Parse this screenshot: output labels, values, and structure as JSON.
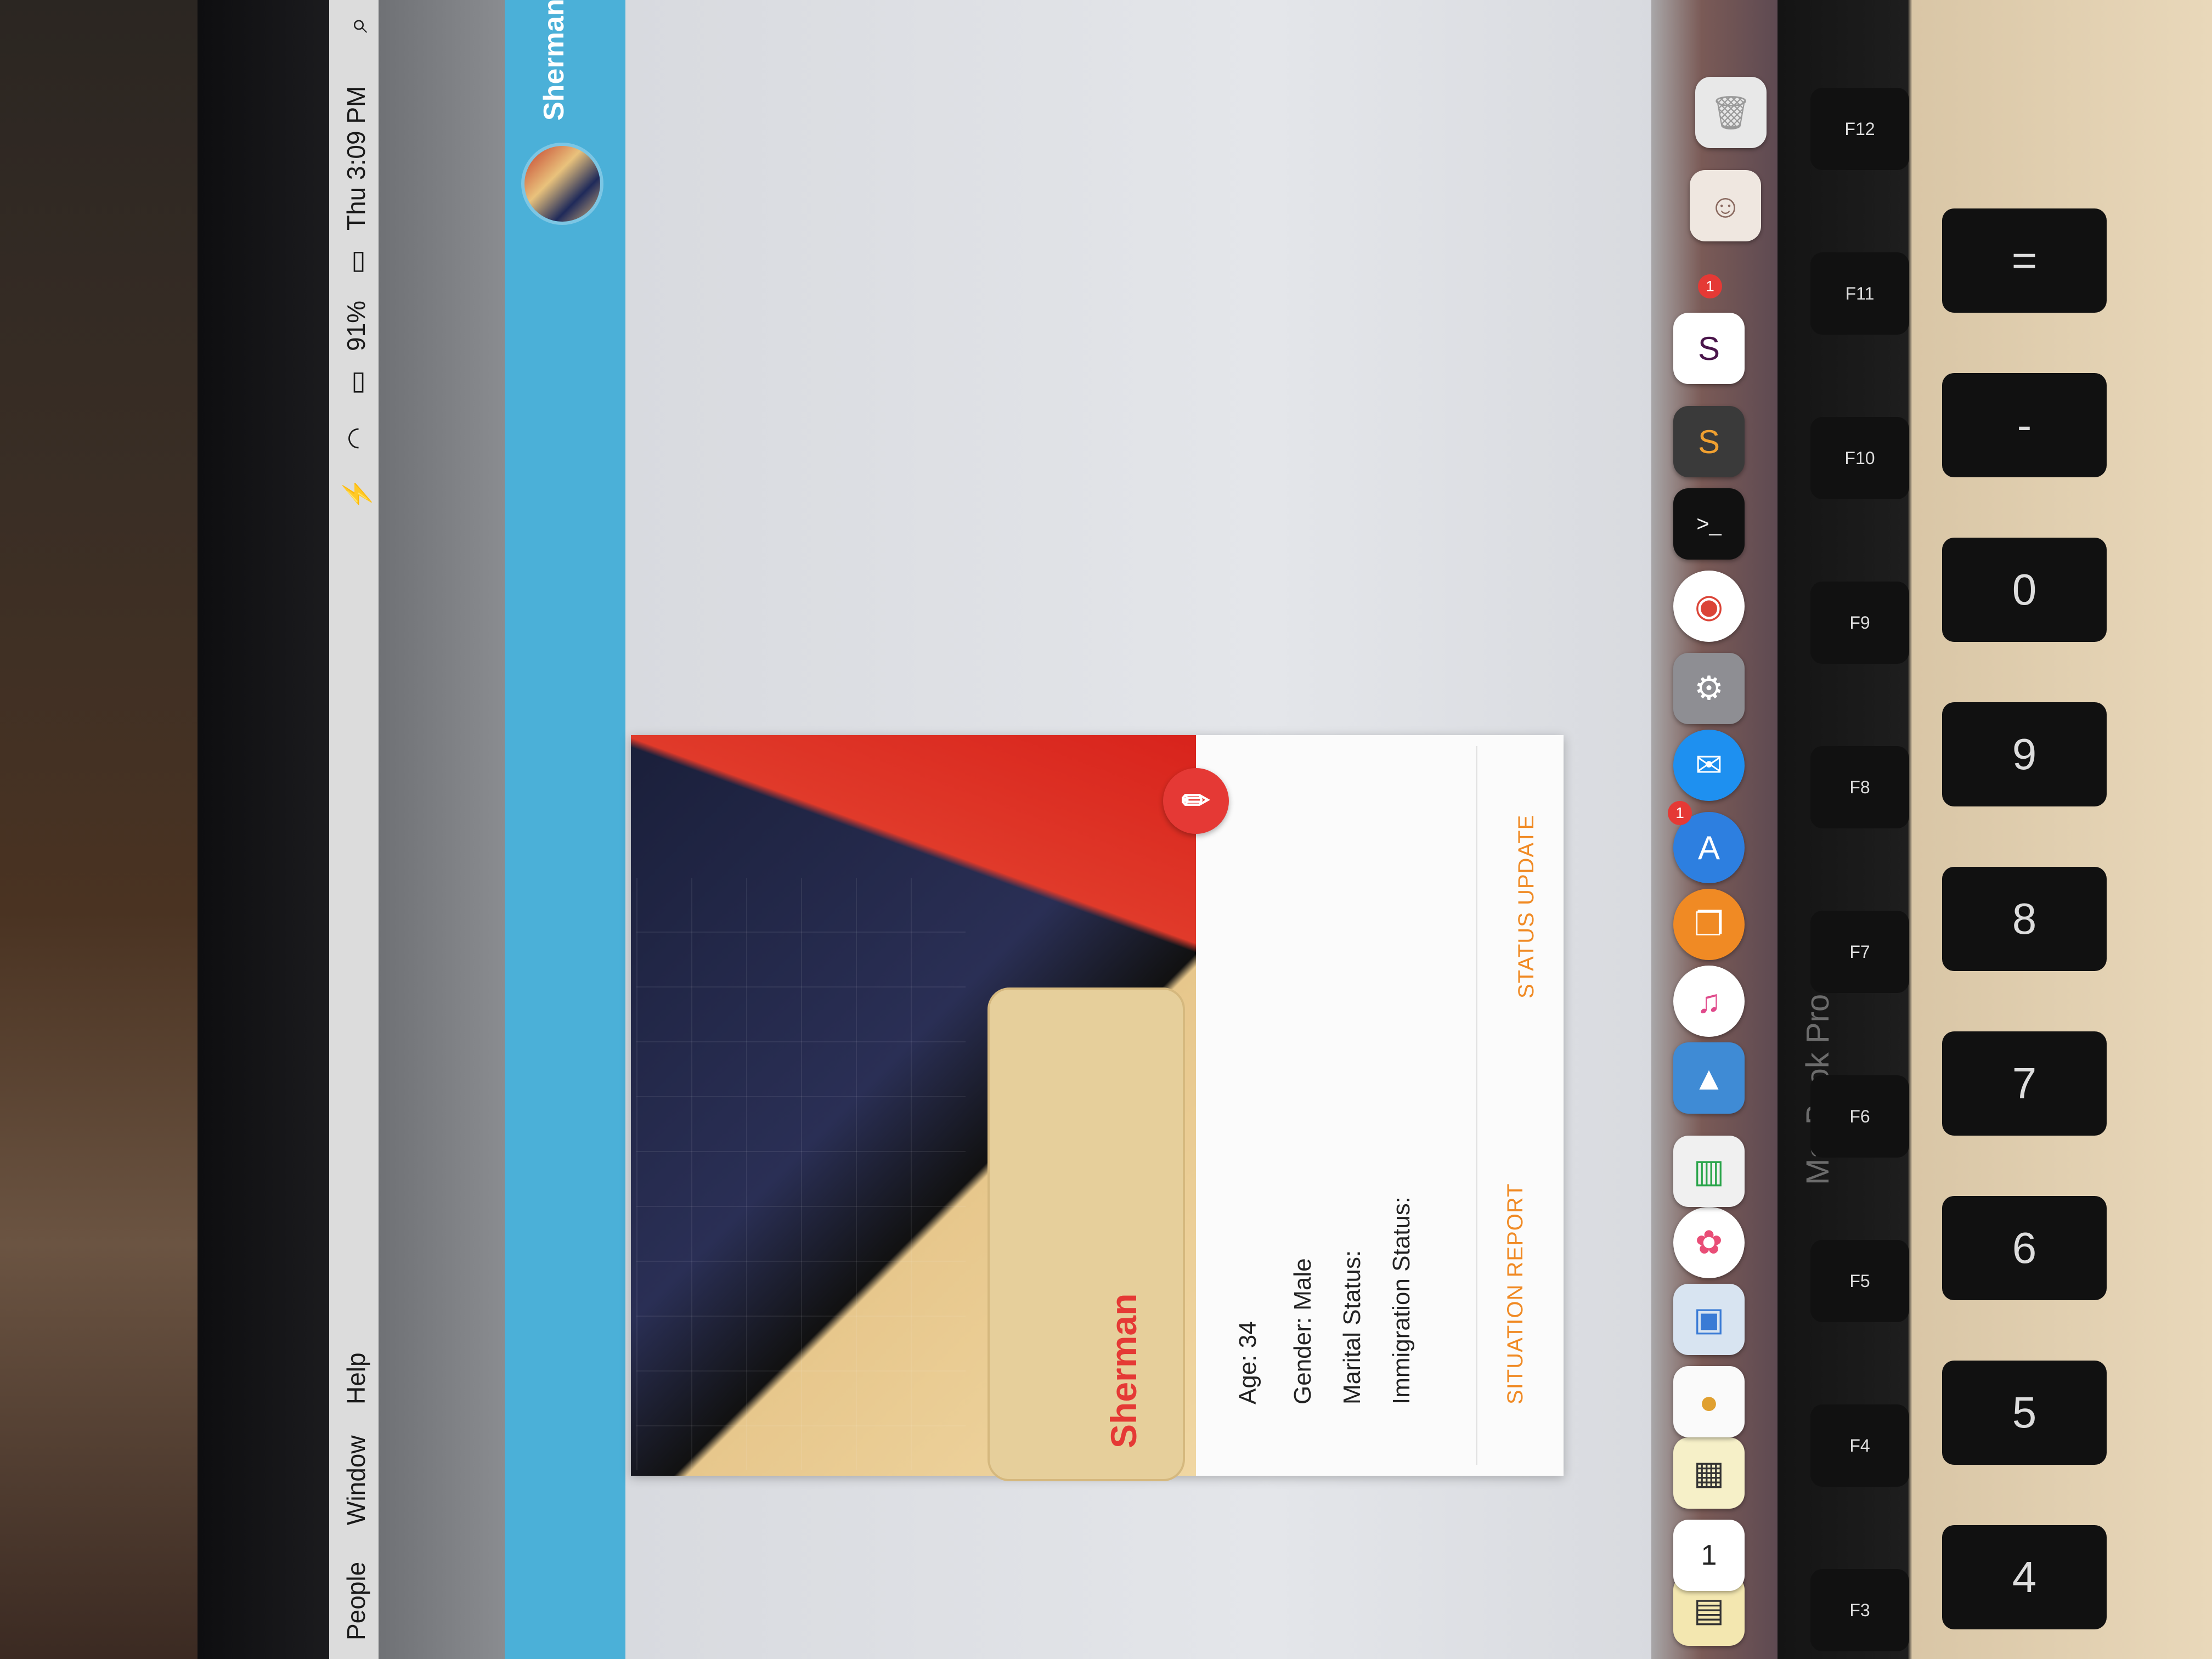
{
  "menubar": {
    "items": [
      "People",
      "Window",
      "Help"
    ],
    "battery": "91%",
    "clock": "Thu 3:09 PM"
  },
  "appbar": {
    "user_name": "Sherman"
  },
  "profile": {
    "name": "Sherman",
    "age": "Age: 34",
    "gender": "Gender: Male",
    "marital_status": "Marital Status:",
    "immigration_status": "Immigration Status:",
    "actions": {
      "situation_report": "SITUATION REPORT",
      "status_update": "STATUS UPDATE"
    },
    "edit_icon": "pencil-icon"
  },
  "dock": {
    "calendar_day": "1",
    "app_store_badge": "1",
    "slack_badge": "1"
  },
  "laptop": {
    "brand": "MacBook Pro",
    "keys": [
      "4",
      "5",
      "6",
      "7",
      "8",
      "9",
      "0",
      "-",
      "="
    ],
    "fn_keys": [
      "F3",
      "F4",
      "F5",
      "F6",
      "F7",
      "F8",
      "F9",
      "F10",
      "F11",
      "F12"
    ]
  },
  "colors": {
    "appbar": "#4bb0d8",
    "accent_red": "#e53935",
    "action_orange": "#f08a24"
  }
}
